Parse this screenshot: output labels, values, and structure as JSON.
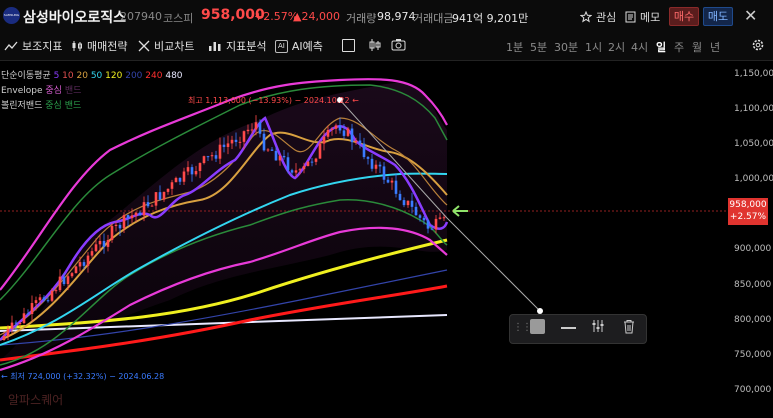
{
  "header": {
    "logo_text": "SAMSUNG BIOLOGICS",
    "name": "삼성바이오로직스",
    "code": "207940",
    "market": "코스피",
    "price": "958,000",
    "change_pct": "+2.57%",
    "change_amt": "▲24,000",
    "volume_label": "거래량",
    "volume": "98,974",
    "amount_label": "거래대금",
    "amount": "941억 9,201만",
    "watch_label": "관심",
    "memo_label": "메모",
    "buy_label": "매수",
    "sell_label": "매도",
    "close_label": "✕"
  },
  "toolbar": {
    "indicators": "보조지표",
    "strategy": "매매전략",
    "compare": "비교차트",
    "analysis": "지표분석",
    "ai_badge": "AI",
    "ai": "AI예측",
    "timeframes": [
      "1분",
      "5분",
      "30분",
      "1시",
      "2시",
      "4시",
      "일",
      "주",
      "월",
      "년"
    ],
    "active_timeframe": "일"
  },
  "legend": {
    "ma_label": "단순이동평균",
    "ma_periods": [
      "5",
      "10",
      "20",
      "50",
      "120",
      "200",
      "240",
      "480"
    ],
    "envelope_label": "Envelope",
    "envelope_center": "중심",
    "envelope_band": "밴드",
    "bb_label": "볼린저밴드",
    "bb_center": "중심",
    "bb_band": "밴드"
  },
  "annotations": {
    "high": "최고 1,113,000 (−13.93%) − 2024.10.22 ←",
    "low": "← 최저 724,000 (+32.32%) − 2024.06.28"
  },
  "y_axis": [
    "1,150,000",
    "1,100,000",
    "1,050,000",
    "1,000,000",
    "950,000",
    "900,000",
    "850,000",
    "800,000",
    "750,000",
    "700,000"
  ],
  "last_price": {
    "price": "958,000",
    "pct": "+2.57%"
  },
  "watermark": "알파스퀘어",
  "colors": {
    "up": "#ff4a4a",
    "down": "#3a7bff",
    "accent_green": "#7ed321"
  }
}
